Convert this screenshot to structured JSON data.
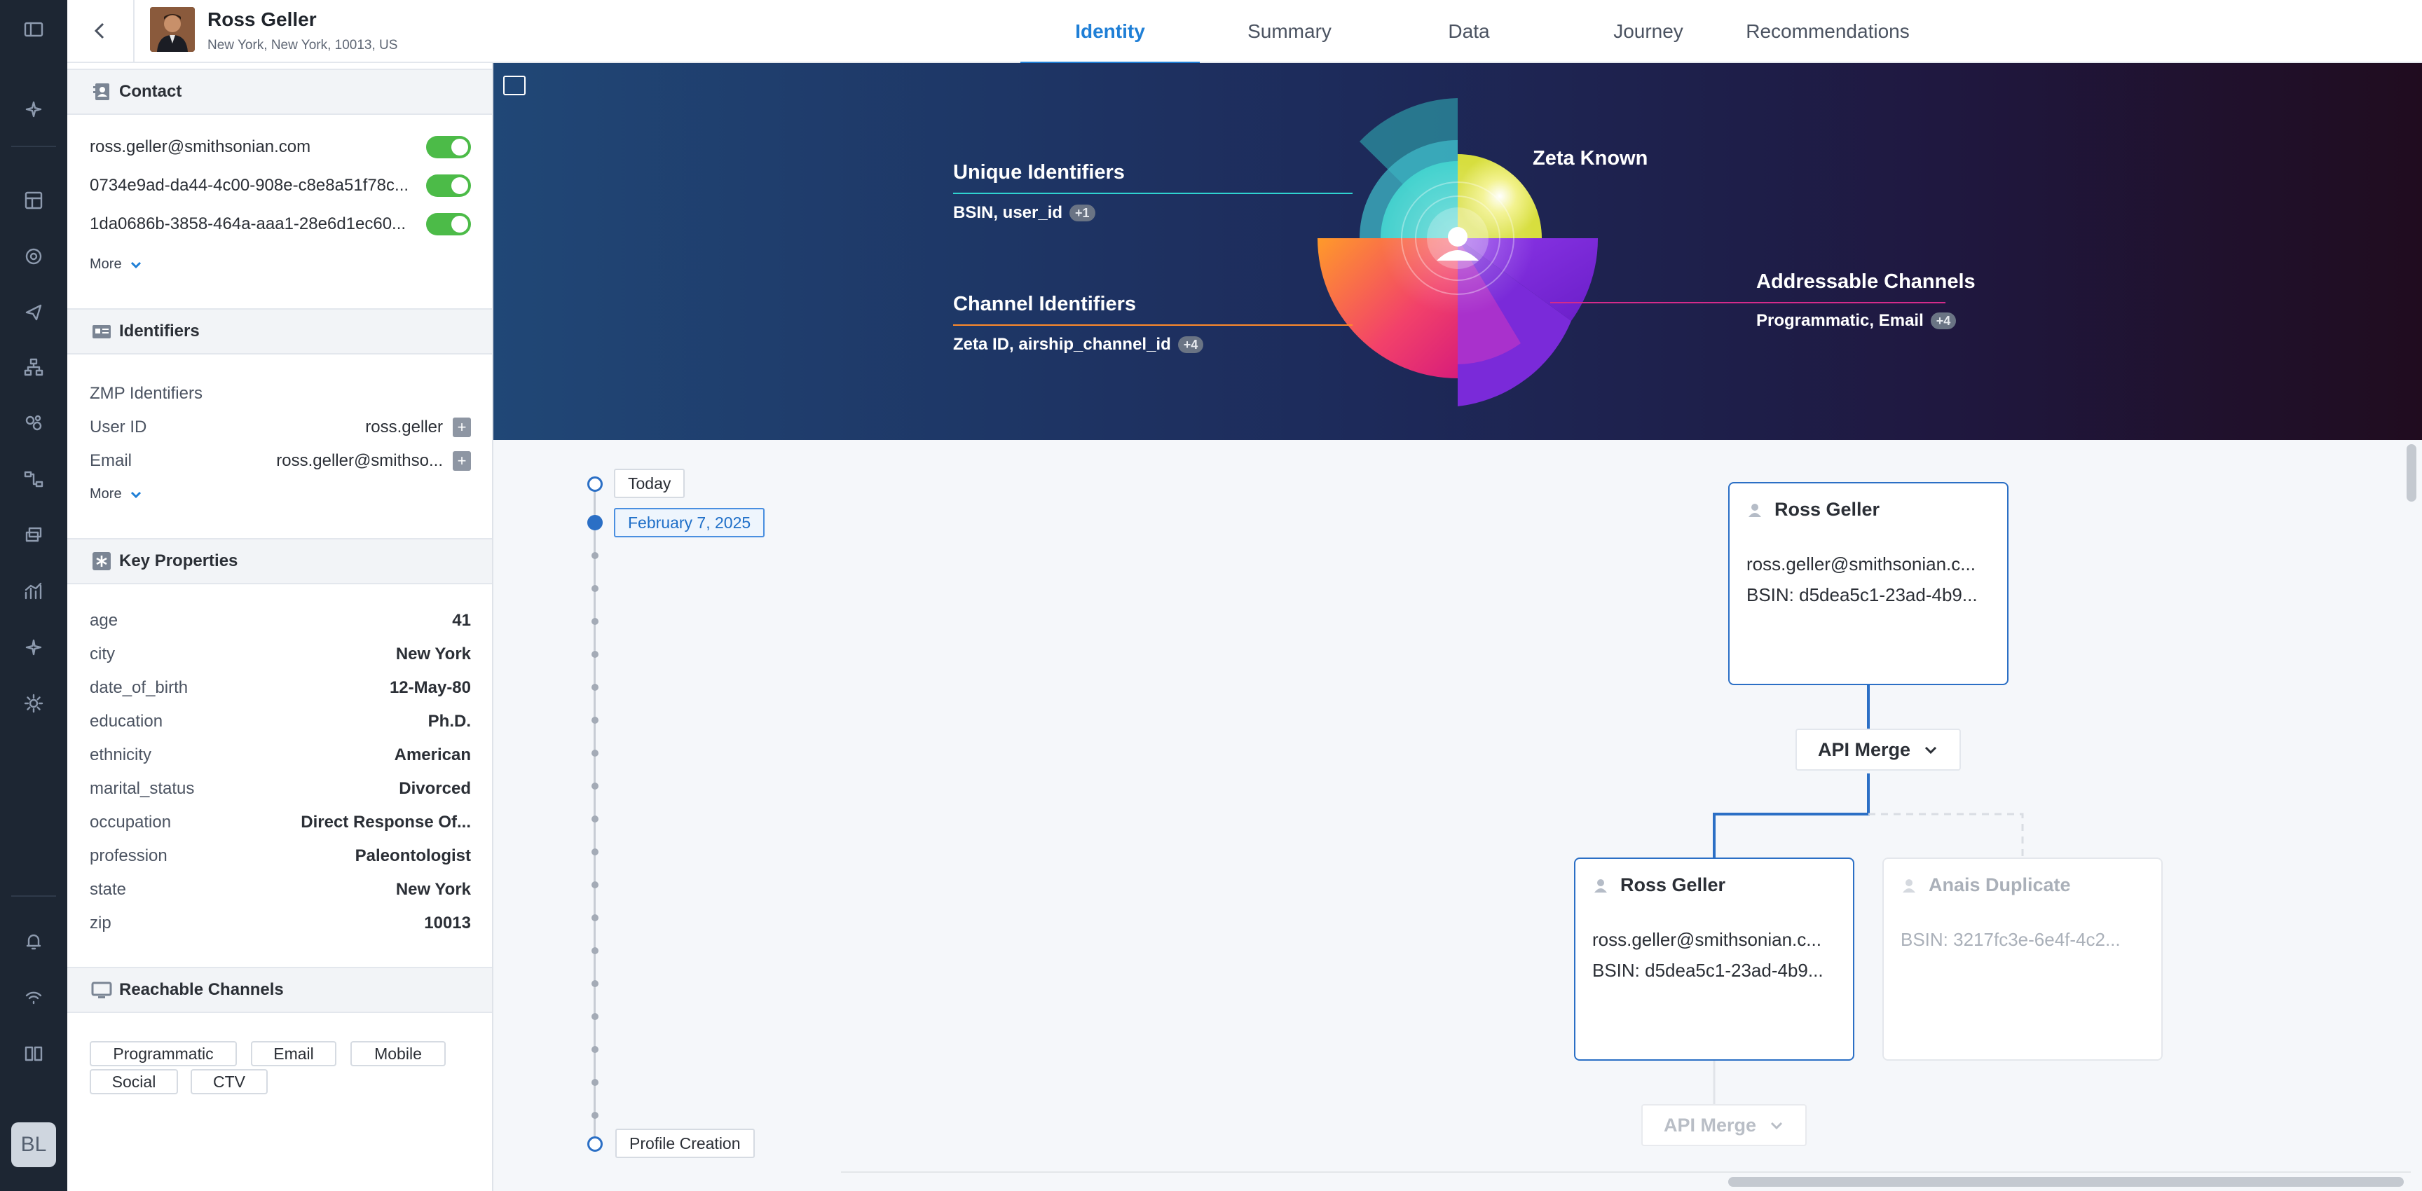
{
  "header": {
    "name": "Ross Geller",
    "address": "New York, New York, 10013, US",
    "tabs": [
      {
        "label": "Identity",
        "active": true
      },
      {
        "label": "Summary",
        "active": false
      },
      {
        "label": "Data",
        "active": false
      },
      {
        "label": "Journey",
        "active": false
      },
      {
        "label": "Recommendations",
        "active": false
      }
    ]
  },
  "rail": {
    "icons": [
      "panel-icon",
      "sparkle-icon",
      "dashboard-icon",
      "target-icon",
      "send-icon",
      "hierarchy-icon",
      "segments-icon",
      "flow-icon",
      "layers-icon",
      "analytics-icon",
      "ai-icon",
      "settings-icon",
      "bell-icon",
      "signal-icon",
      "book-icon"
    ],
    "user_initials": "BL"
  },
  "contact": {
    "title": "Contact",
    "items": [
      {
        "value": "ross.geller@smithsonian.com",
        "enabled": true
      },
      {
        "value": "0734e9ad-da44-4c00-908e-c8e8a51f78c...",
        "enabled": true
      },
      {
        "value": "1da0686b-3858-464a-aaa1-28e6d1ec60...",
        "enabled": true
      }
    ],
    "more": "More"
  },
  "identifiers": {
    "title": "Identifiers",
    "group": "ZMP Identifiers",
    "items": [
      {
        "label": "User ID",
        "value": "ross.geller"
      },
      {
        "label": "Email",
        "value": "ross.geller@smithso..."
      }
    ],
    "more": "More"
  },
  "key_properties": {
    "title": "Key Properties",
    "items": [
      {
        "label": "age",
        "value": "41"
      },
      {
        "label": "city",
        "value": "New York"
      },
      {
        "label": "date_of_birth",
        "value": "12-May-80"
      },
      {
        "label": "education",
        "value": "Ph.D."
      },
      {
        "label": "ethnicity",
        "value": "American"
      },
      {
        "label": "marital_status",
        "value": "Divorced"
      },
      {
        "label": "occupation",
        "value": "Direct Response Of..."
      },
      {
        "label": "profession",
        "value": "Paleontologist"
      },
      {
        "label": "state",
        "value": "New York"
      },
      {
        "label": "zip",
        "value": "10013"
      }
    ]
  },
  "reachable_channels": {
    "title": "Reachable Channels",
    "chips": [
      "Programmatic",
      "Email",
      "Mobile",
      "Social",
      "CTV"
    ]
  },
  "hero": {
    "unique_identifiers": {
      "title": "Unique Identifiers",
      "values": "BSIN, user_id",
      "extra": "+1"
    },
    "zeta_known": {
      "title": "Zeta Known"
    },
    "channel_identifiers": {
      "title": "Channel Identifiers",
      "values": "Zeta ID, airship_channel_id",
      "extra": "+4"
    },
    "addressable_channels": {
      "title": "Addressable Channels",
      "values": "Programmatic, Email",
      "extra": "+4"
    }
  },
  "timeline": {
    "top_label": "Today",
    "selected_date": "February 7, 2025",
    "bottom_label": "Profile Creation"
  },
  "graph": {
    "top_card": {
      "name": "Ross Geller",
      "email": "ross.geller@smithsonian.c...",
      "bsin": "BSIN: d5dea5c1-23ad-4b9..."
    },
    "merge_1": "API Merge",
    "left_card": {
      "name": "Ross Geller",
      "email": "ross.geller@smithsonian.c...",
      "bsin": "BSIN: d5dea5c1-23ad-4b9..."
    },
    "right_card": {
      "name": "Anais Duplicate",
      "bsin": "BSIN: 3217fc3e-6e4f-4c2..."
    },
    "merge_2": "API Merge"
  },
  "colors": {
    "accent": "#1f7fd6",
    "toggle_on": "#4cbb48",
    "card_border": "#2b6fc5"
  }
}
